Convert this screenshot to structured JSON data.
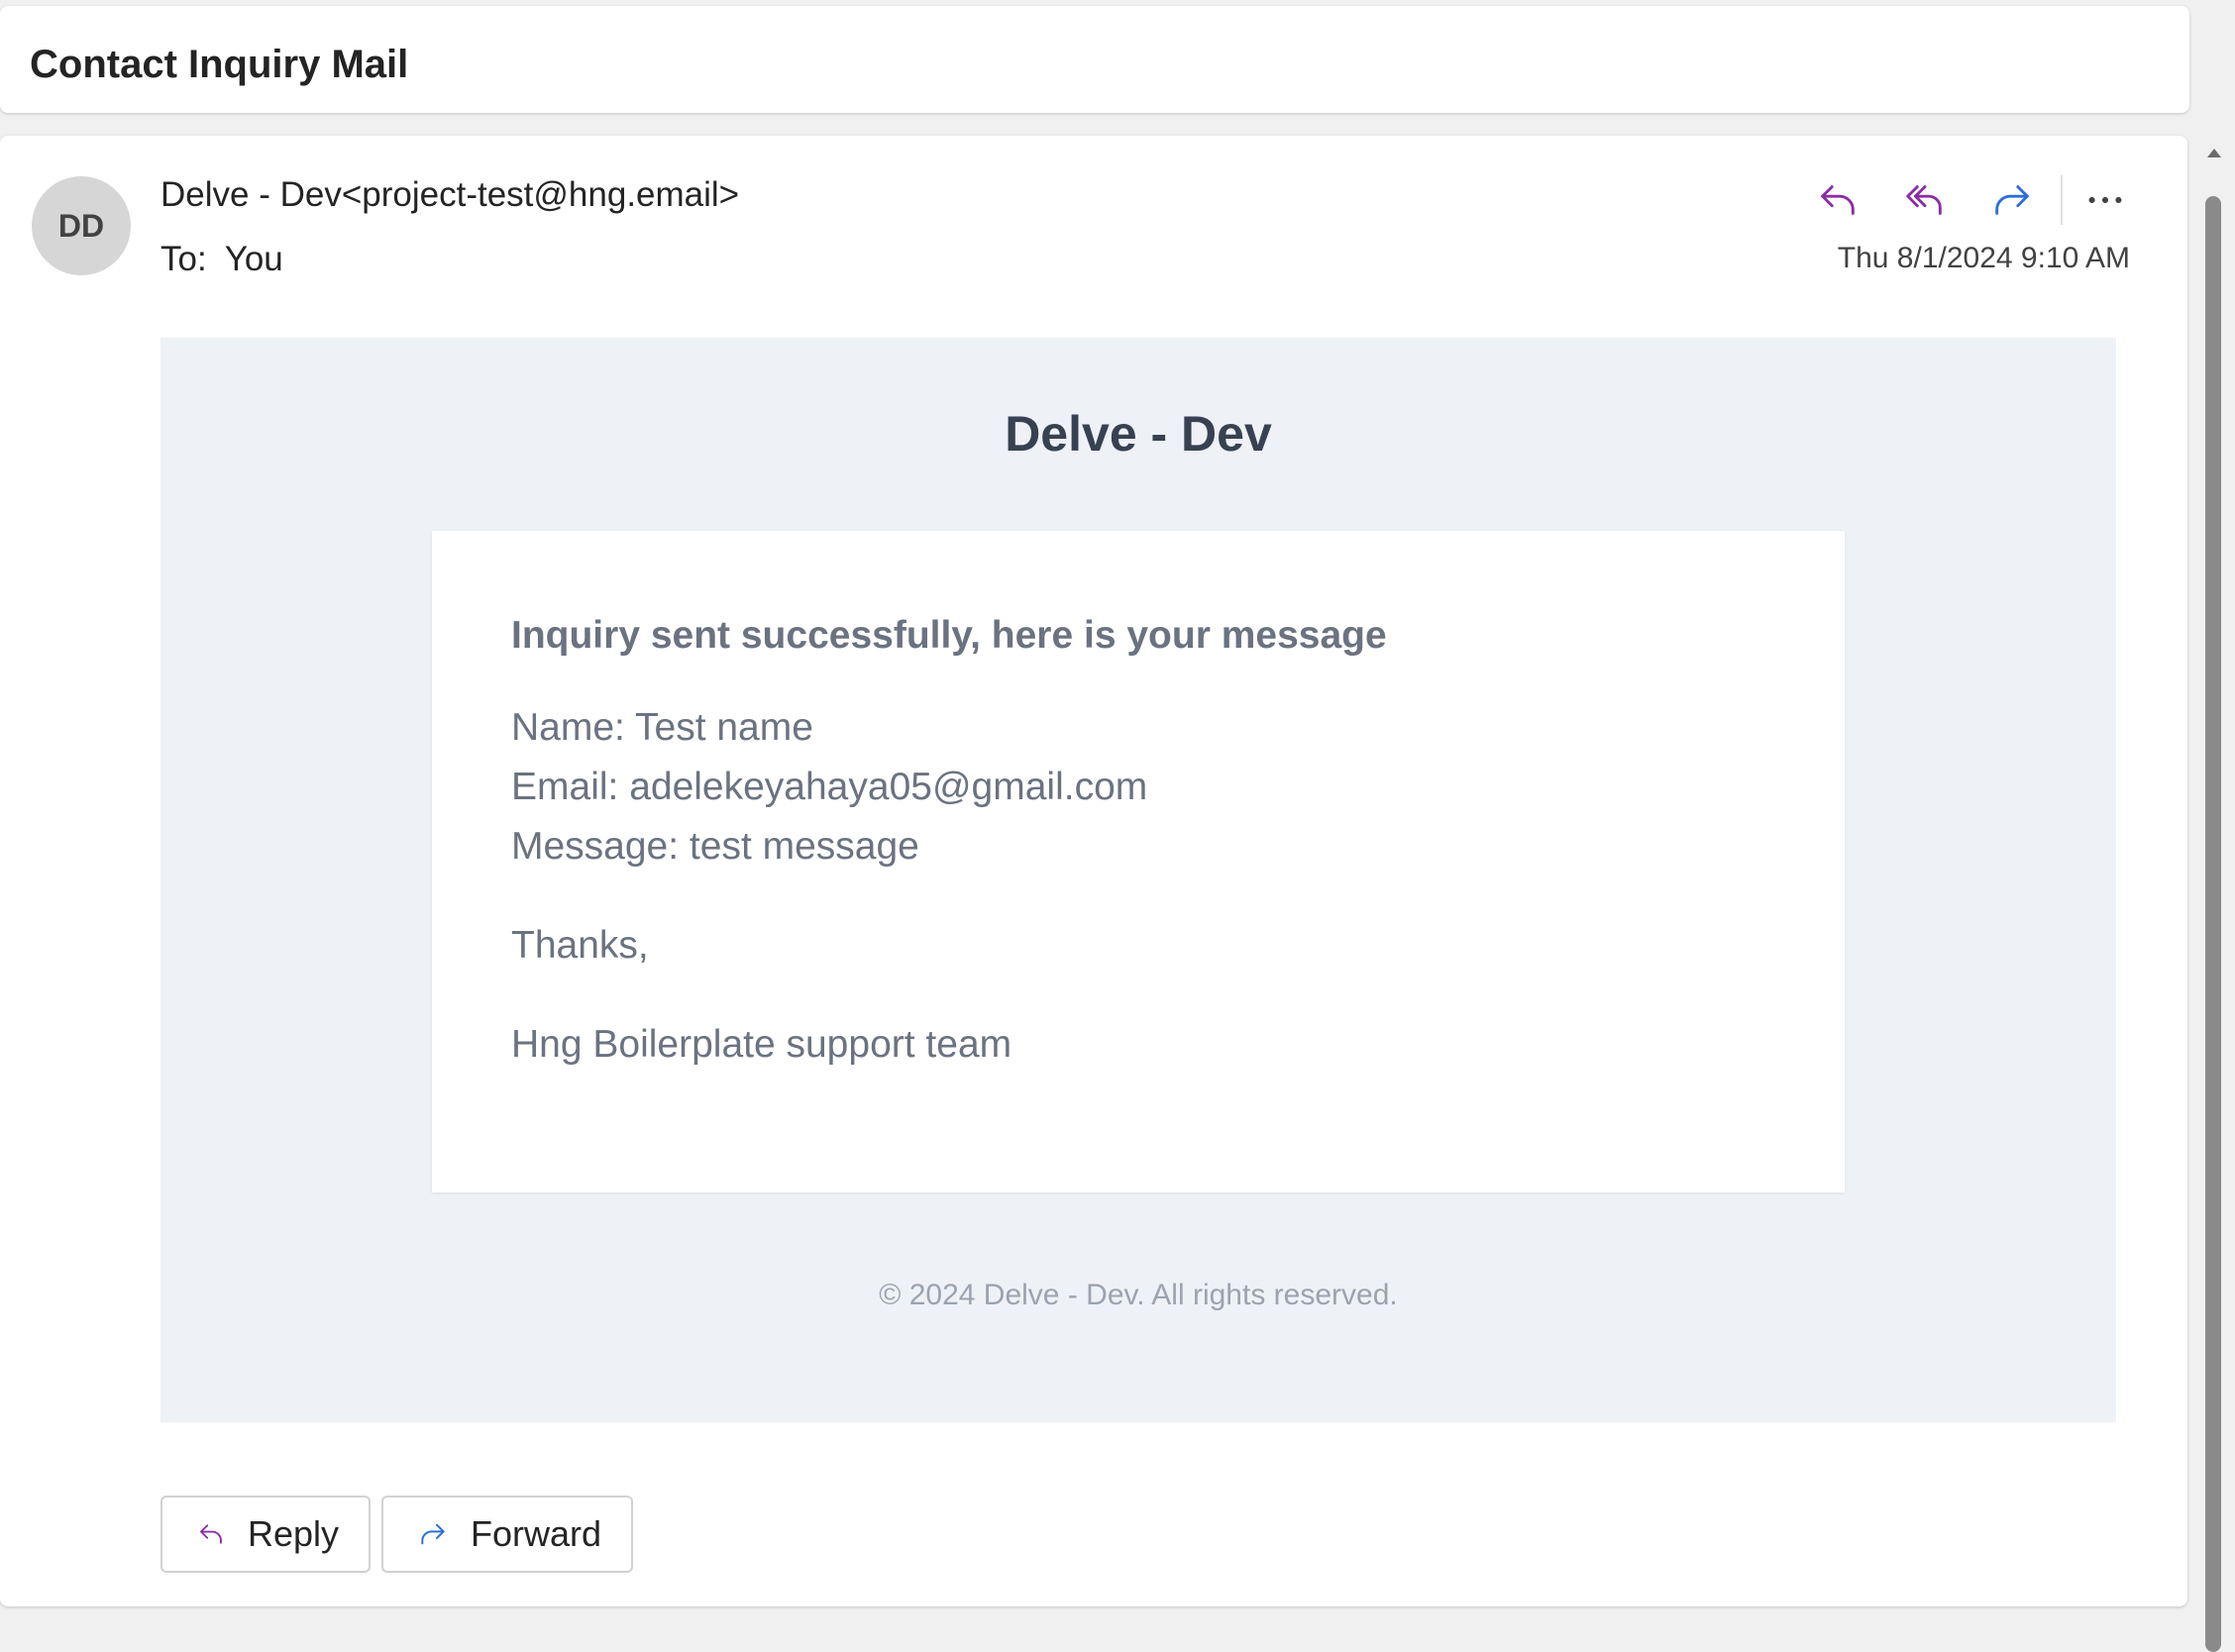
{
  "subject": "Contact Inquiry Mail",
  "header": {
    "avatar_initials": "DD",
    "sender": "Delve - Dev<project-test@hng.email>",
    "to_label": "To:",
    "to_value": "You",
    "timestamp": "Thu 8/1/2024 9:10 AM",
    "actions": [
      {
        "name": "reply",
        "icon": "reply-icon",
        "color": "#8a2da5"
      },
      {
        "name": "reply-all",
        "icon": "reply-all-icon",
        "color": "#8a2da5"
      },
      {
        "name": "forward",
        "icon": "forward-icon",
        "color": "#2b6fd6"
      },
      {
        "name": "more",
        "icon": "more-icon",
        "color": "#424242"
      }
    ]
  },
  "email_body": {
    "brand": "Delve - Dev",
    "heading": "Inquiry sent successfully, here is your message",
    "name_line": "Name: Test name",
    "email_line": "Email: adelekeyahaya05@gmail.com",
    "message_line": "Message: test message",
    "thanks": "Thanks,",
    "team": "Hng Boilerplate support team",
    "footer": "© 2024 Delve - Dev. All rights reserved."
  },
  "footer_buttons": {
    "reply_label": "Reply",
    "forward_label": "Forward"
  },
  "colors": {
    "reply_accent": "#8a2da5",
    "forward_accent": "#2b6fd6",
    "body_panel": "#eef1f6"
  }
}
